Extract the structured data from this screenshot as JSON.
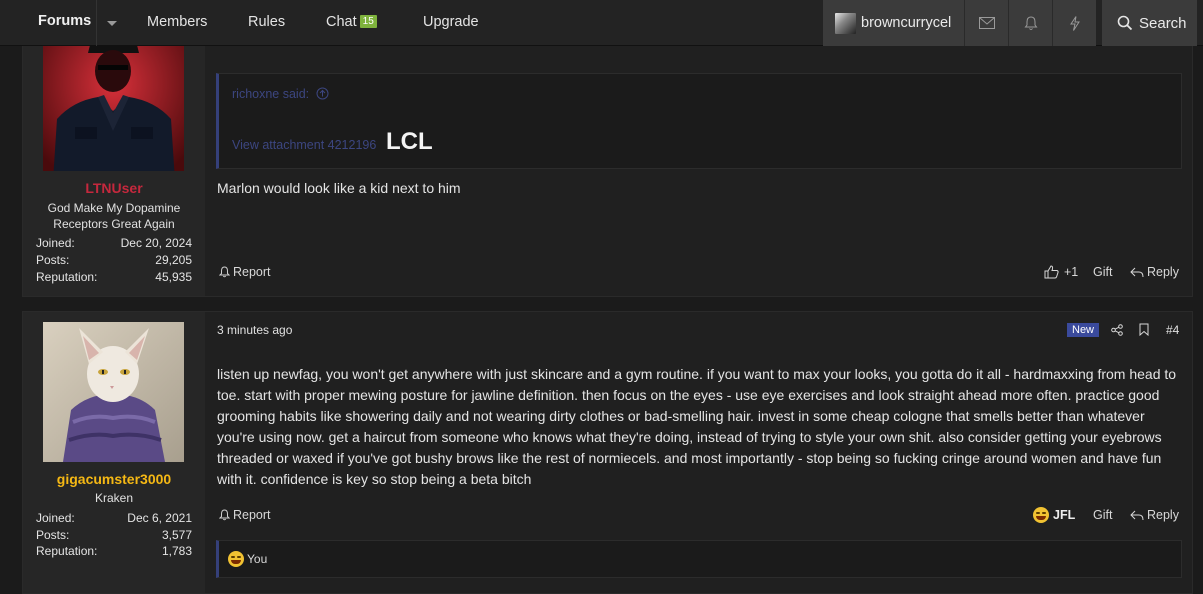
{
  "nav": {
    "forums": "Forums",
    "members": "Members",
    "rules": "Rules",
    "chat": "Chat",
    "chat_count": "15",
    "upgrade": "Upgrade",
    "username": "browncurrycel",
    "search": "Search"
  },
  "colors": {
    "accent_blue": "#35407a",
    "chat_badge": "#7fb33d",
    "username_red": "#c5283d",
    "username_gold": "#f5b814",
    "new_badge": "#3a4a9c"
  },
  "posts": [
    {
      "author": "LTNUser",
      "title": "God Make My Dopamine Receptors Great Again",
      "stats": [
        {
          "label": "Joined:",
          "value": "Dec 20, 2024"
        },
        {
          "label": "Posts:",
          "value": "29,205"
        },
        {
          "label": "Reputation:",
          "value": "45,935"
        }
      ],
      "quote": {
        "author": "richoxne said:",
        "attachment": "View attachment 4212196",
        "big_text": "LCL"
      },
      "body": "Marlon would look like a kid next to him",
      "actions": {
        "report": "Report",
        "like": "+1",
        "gift": "Gift",
        "reply": "Reply"
      }
    },
    {
      "author": "gigacumster3000",
      "title": "Kraken",
      "time": "3 minutes ago",
      "badge": "New",
      "number": "#4",
      "stats": [
        {
          "label": "Joined:",
          "value": "Dec 6, 2021"
        },
        {
          "label": "Posts:",
          "value": "3,577"
        },
        {
          "label": "Reputation:",
          "value": "1,783"
        }
      ],
      "body": "listen up newfag, you won't get anywhere with just skincare and a gym routine. if you want to max your looks, you gotta do it all - hardmaxxing from head to toe. start with proper mewing posture for jawline definition. then focus on the eyes - use eye exercises and look straight ahead more often. practice good grooming habits like showering daily and not wearing dirty clothes or bad-smelling hair. invest in some cheap cologne that smells better than whatever you're using now. get a haircut from someone who knows what they're doing, instead of trying to style your own shit. also consider getting your eyebrows threaded or waxed if you've got bushy brows like the rest of normiecels. and most importantly - stop being so fucking cringe around women and have fun with it. confidence is key so stop being a beta bitch",
      "actions": {
        "report": "Report",
        "reaction": "JFL",
        "gift": "Gift",
        "reply": "Reply"
      },
      "reactions_by": "You"
    }
  ]
}
